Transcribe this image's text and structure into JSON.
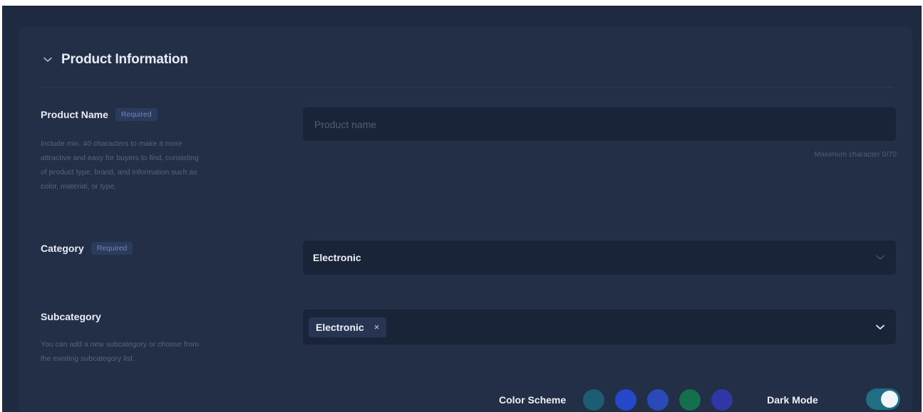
{
  "section": {
    "title": "Product Information",
    "chevron_icon": "chevron-down-icon"
  },
  "product_name": {
    "label": "Product Name",
    "badge": "Required",
    "help_lines": [
      "Include min. 40 characters to make it more",
      "attractive and easy for buyers to find, consisting",
      "of product type, brand, and information such as",
      "color, material, or type."
    ],
    "placeholder": "Product name",
    "value": "",
    "counter": "Maximum character 0/70"
  },
  "category": {
    "label": "Category",
    "badge": "Required",
    "value": "Electronic",
    "chevron_icon": "chevron-down-icon"
  },
  "subcategory": {
    "label": "Subcategory",
    "help_lines": [
      "You can add a new subcategory or choose from",
      "the existing subcategory list."
    ],
    "tag": "Electronic",
    "tag_remove": "×",
    "chevron_icon": "chevron-down-icon"
  },
  "footer": {
    "color_scheme_label": "Color Scheme",
    "swatches": [
      "#1d5d73",
      "#2547c9",
      "#2c49b8",
      "#136f4c",
      "#3136a6"
    ],
    "dark_mode_label": "Dark Mode",
    "dark_mode_on": true
  },
  "colors": {
    "background": "#1e2a40",
    "card": "#222f47",
    "input": "#1a2438",
    "badge_bg": "#2b3b5c",
    "toggle_on": "#1e6f84"
  }
}
